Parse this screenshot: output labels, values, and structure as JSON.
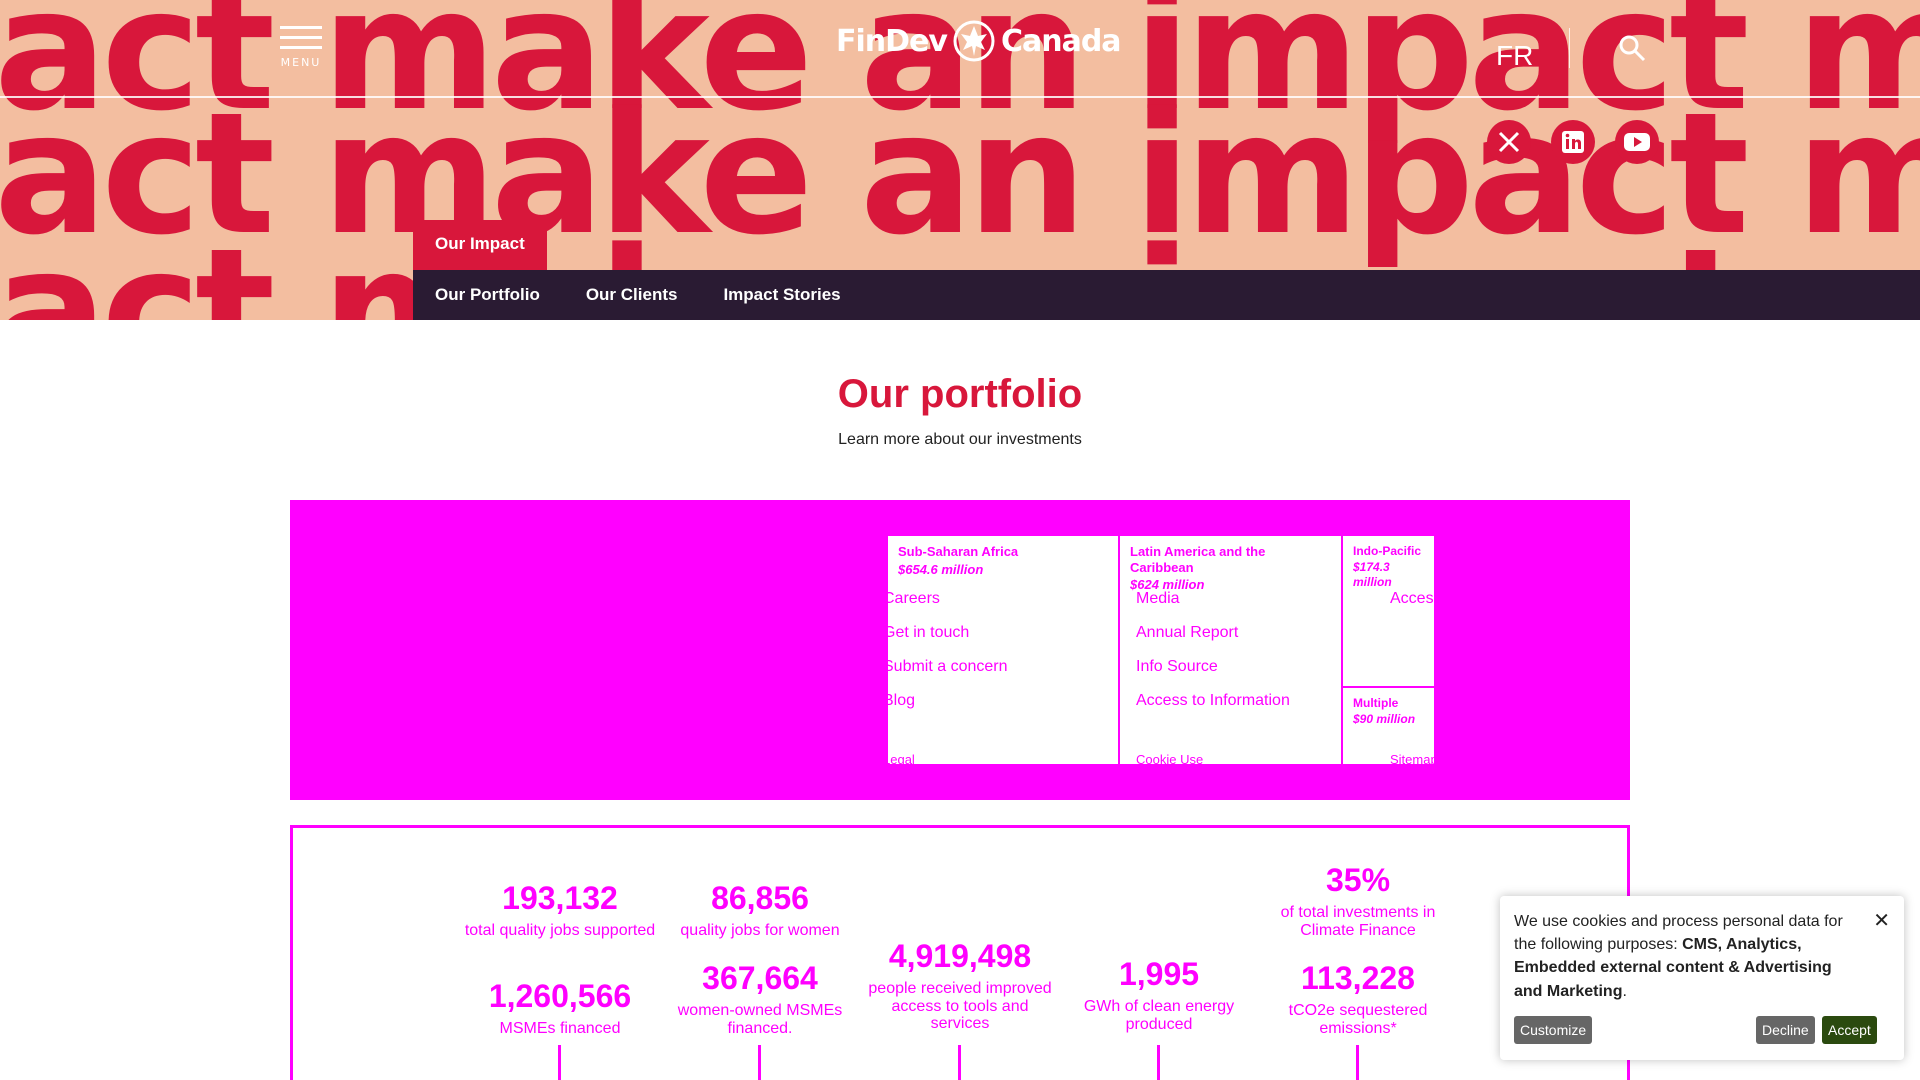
{
  "header": {
    "menu_label": "MENU",
    "logo_left": "FinDev",
    "logo_right": "Canada",
    "lang": "FR",
    "bg_words": "make an impact make an impact make an impact"
  },
  "section_label": "Our Impact",
  "subnav": [
    "Our Portfolio",
    "Our Clients",
    "Impact Stories"
  ],
  "page": {
    "title": "Our portfolio",
    "subtitle": "Learn more about our investments"
  },
  "treemap": [
    {
      "name": "Sub-Saharan Africa",
      "value": "$654.6 million"
    },
    {
      "name": "Latin America and the Caribbean",
      "value": "$624 million"
    },
    {
      "name": "Indo-Pacific",
      "value": "$174.3 million"
    },
    {
      "name": "Multiple",
      "value": "$90 million"
    }
  ],
  "footer_links": {
    "col1": [
      "Careers",
      "Get in touch",
      "Submit a concern",
      "Blog"
    ],
    "col2": [
      "Media",
      "Annual Report",
      "Info Source",
      "Access to Information"
    ],
    "col3": [
      "Accessibility"
    ],
    "legal": [
      "Legal",
      "Cookie Use",
      "Sitemap"
    ]
  },
  "stats": [
    {
      "num": "193,132",
      "label": "total quality jobs supported"
    },
    {
      "num": "1,260,566",
      "label": "MSMEs financed"
    },
    {
      "num": "86,856",
      "label": "quality jobs for women"
    },
    {
      "num": "367,664",
      "label": "women-owned MSMEs financed."
    },
    {
      "num": "4,919,498",
      "label": "people received improved access to tools and services"
    },
    {
      "num": "1,995",
      "label": "GWh of clean energy produced"
    },
    {
      "num": "35%",
      "label": "of total investments in Climate Finance"
    },
    {
      "num": "113,228",
      "label": "tCO2e sequestered emissions*"
    }
  ],
  "cookie": {
    "text_prefix": "We use cookies and process personal data for the following purposes: ",
    "purposes": "CMS, Analytics, Embedded external content & Advertising and Marketing",
    "text_suffix": ".",
    "close": "✕",
    "customize": "Customize",
    "decline": "Decline",
    "accept": "Accept"
  },
  "colors": {
    "brand_red": "#d8173b",
    "hero_bg": "#f3bea0",
    "subnav_bg": "#2a1b33",
    "magenta": "#ff00ff",
    "accept": "#2b4a0f"
  }
}
